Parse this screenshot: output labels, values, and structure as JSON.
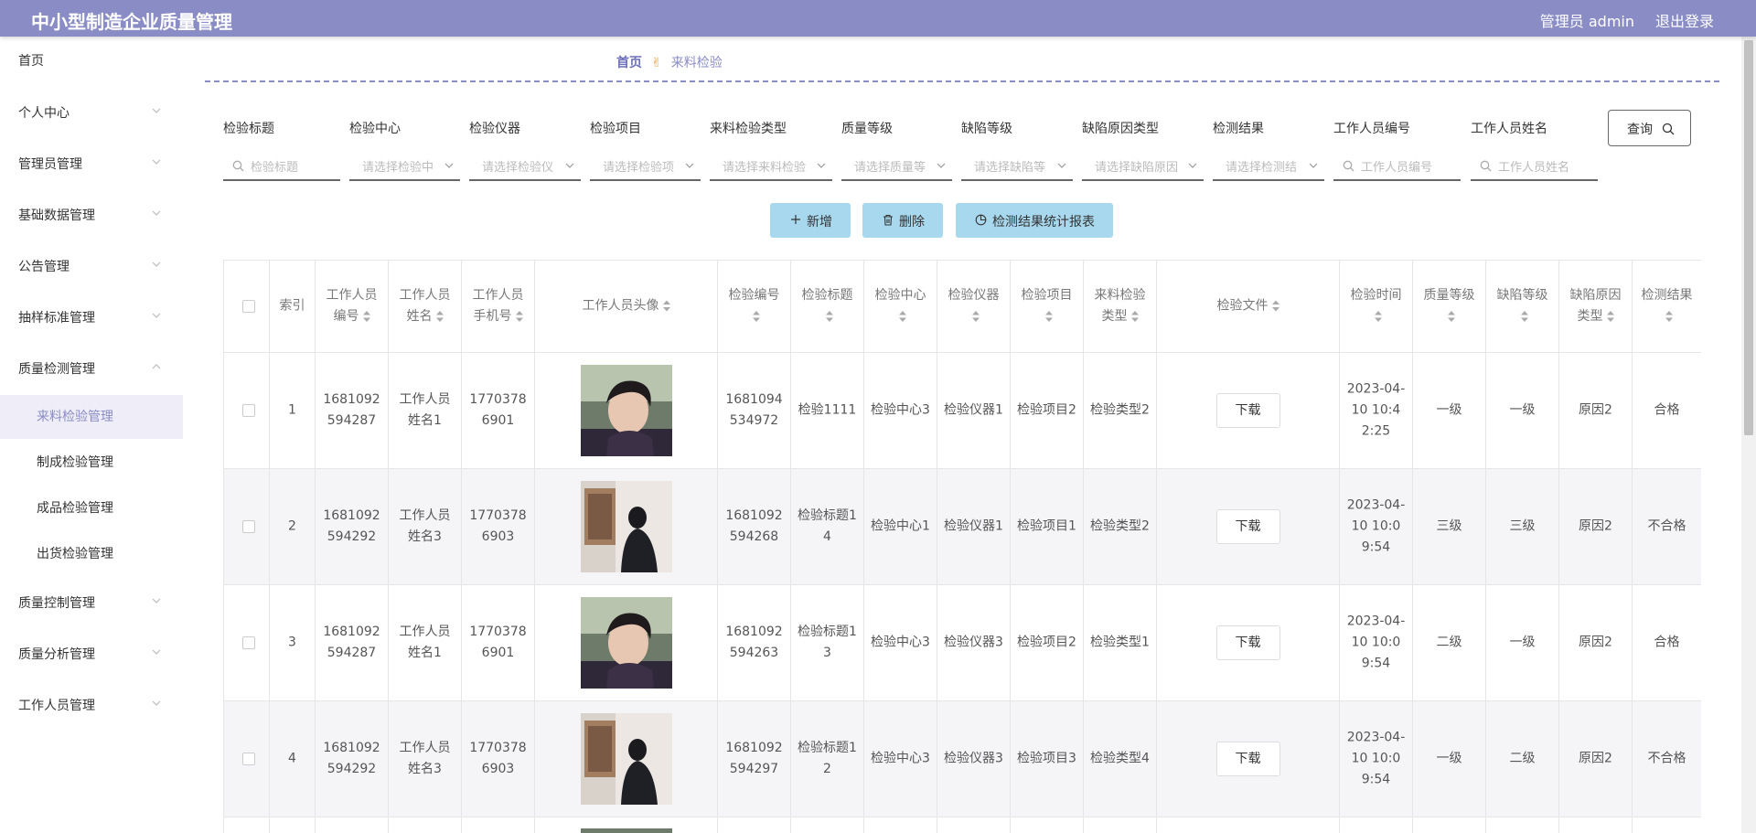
{
  "header": {
    "title": "中小型制造企业质量管理",
    "user": "管理员 admin",
    "logout": "退出登录"
  },
  "sidebar": {
    "items": [
      {
        "label": "首页"
      },
      {
        "label": "个人中心"
      },
      {
        "label": "管理员管理"
      },
      {
        "label": "基础数据管理"
      },
      {
        "label": "公告管理"
      },
      {
        "label": "抽样标准管理"
      },
      {
        "label": "质量检测管理"
      },
      {
        "label": "质量控制管理"
      },
      {
        "label": "质量分析管理"
      },
      {
        "label": "工作人员管理"
      }
    ],
    "subitems": [
      {
        "label": "来料检验管理"
      },
      {
        "label": "制成检验管理"
      },
      {
        "label": "成品检验管理"
      },
      {
        "label": "出货检验管理"
      }
    ]
  },
  "breadcrumb": {
    "home": "首页",
    "sep": "✌",
    "current": "来料检验"
  },
  "filters": [
    {
      "label": "检验标题",
      "placeholder": "检验标题"
    },
    {
      "label": "检验中心",
      "placeholder": "请选择检验中"
    },
    {
      "label": "检验仪器",
      "placeholder": "请选择检验仪"
    },
    {
      "label": "检验项目",
      "placeholder": "请选择检验项"
    },
    {
      "label": "来料检验类型",
      "placeholder": "请选择来料检验"
    },
    {
      "label": "质量等级",
      "placeholder": "请选择质量等"
    },
    {
      "label": "缺陷等级",
      "placeholder": "请选择缺陷等"
    },
    {
      "label": "缺陷原因类型",
      "placeholder": "请选择缺陷原因"
    },
    {
      "label": "检测结果",
      "placeholder": "请选择检测结"
    },
    {
      "label": "工作人员编号",
      "placeholder": "工作人员编号"
    },
    {
      "label": "工作人员姓名",
      "placeholder": "工作人员姓名"
    }
  ],
  "query_label": "查询",
  "actions": {
    "add": "新增",
    "delete": "删除",
    "report": "检测结果统计报表"
  },
  "table": {
    "headers": {
      "index": "索引",
      "worker_no": "工作人员编号",
      "worker_name": "工作人员姓名",
      "worker_phone": "工作人员手机号",
      "worker_avatar": "工作人员头像",
      "insp_no": "检验编号",
      "insp_title": "检验标题",
      "insp_center": "检验中心",
      "insp_instrument": "检验仪器",
      "insp_item": "检验项目",
      "incoming_type": "来料检验类型",
      "insp_file": "检验文件",
      "insp_time": "检验时间",
      "quality_grade": "质量等级",
      "defect_grade": "缺陷等级",
      "defect_reason": "缺陷原因类型",
      "result": "检测结果"
    },
    "download_label": "下载",
    "rows": [
      {
        "index": "1",
        "worker_no": "1681092594287",
        "worker_name": "工作人员姓名1",
        "worker_phone": "17703786901",
        "avatar": "man",
        "insp_no": "1681094534972",
        "insp_title": "检验1111",
        "insp_center": "检验中心3",
        "insp_instrument": "检验仪器1",
        "insp_item": "检验项目2",
        "incoming_type": "检验类型2",
        "insp_time": "2023-04-10 10:42:25",
        "quality_grade": "一级",
        "defect_grade": "一级",
        "defect_reason": "原因2",
        "result": "合格"
      },
      {
        "index": "2",
        "worker_no": "1681092594292",
        "worker_name": "工作人员姓名3",
        "worker_phone": "17703786903",
        "avatar": "woman",
        "insp_no": "1681092594268",
        "insp_title": "检验标题14",
        "insp_center": "检验中心1",
        "insp_instrument": "检验仪器1",
        "insp_item": "检验项目1",
        "incoming_type": "检验类型2",
        "insp_time": "2023-04-10 10:09:54",
        "quality_grade": "三级",
        "defect_grade": "三级",
        "defect_reason": "原因2",
        "result": "不合格"
      },
      {
        "index": "3",
        "worker_no": "1681092594287",
        "worker_name": "工作人员姓名1",
        "worker_phone": "17703786901",
        "avatar": "man",
        "insp_no": "1681092594263",
        "insp_title": "检验标题13",
        "insp_center": "检验中心3",
        "insp_instrument": "检验仪器3",
        "insp_item": "检验项目2",
        "incoming_type": "检验类型1",
        "insp_time": "2023-04-10 10:09:54",
        "quality_grade": "二级",
        "defect_grade": "一级",
        "defect_reason": "原因2",
        "result": "合格"
      },
      {
        "index": "4",
        "worker_no": "1681092594292",
        "worker_name": "工作人员姓名3",
        "worker_phone": "17703786903",
        "avatar": "woman",
        "insp_no": "1681092594297",
        "insp_title": "检验标题12",
        "insp_center": "检验中心3",
        "insp_instrument": "检验仪器3",
        "insp_item": "检验项目3",
        "incoming_type": "检验类型4",
        "insp_time": "2023-04-10 10:09:54",
        "quality_grade": "一级",
        "defect_grade": "二级",
        "defect_reason": "原因2",
        "result": "不合格"
      }
    ]
  },
  "colors": {
    "header_bg": "#8a8cc5",
    "accent": "#8a8cc5",
    "action_button": "#a8d8ee",
    "active_menu_bg": "#efeef8"
  }
}
